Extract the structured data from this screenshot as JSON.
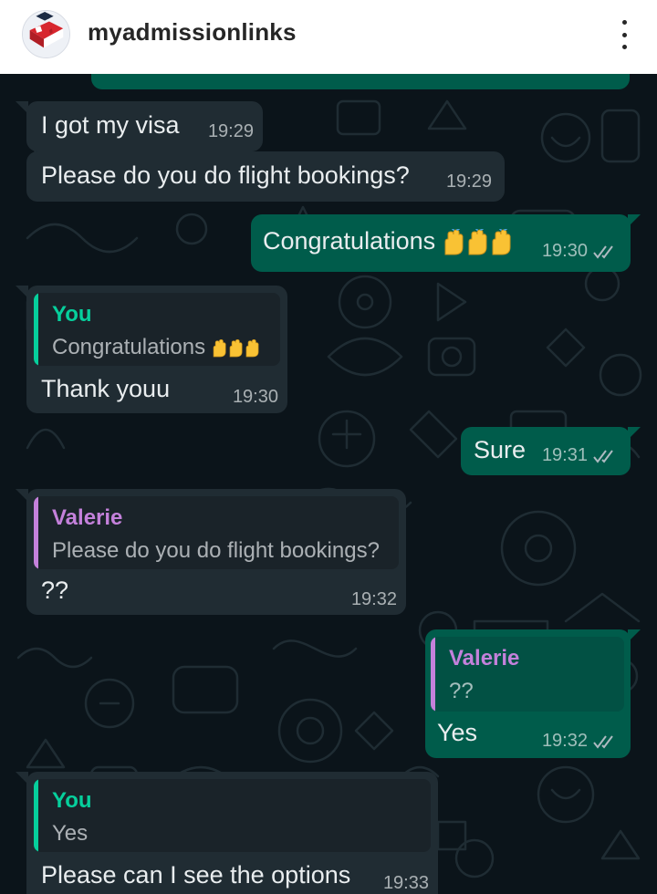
{
  "header": {
    "account_name": "myadmissionlinks",
    "menu_icon": "more-vertical-icon"
  },
  "colors": {
    "chat_bg": "#0b141a",
    "incoming_bubble": "#202c33",
    "outgoing_bubble": "#005c4b",
    "you_name": "#06cf9c",
    "valerie_name": "#c481db",
    "read_ticks": "#aebac1"
  },
  "messages": [
    {
      "text": "I got my visa",
      "time": "19:29"
    },
    {
      "text": "Please do you do flight bookings?",
      "time": "19:29"
    },
    {
      "text": "Congratulations",
      "emoji": "raising-hands-x3",
      "time": "19:30",
      "status": "read"
    },
    {
      "quote_name": "You",
      "quote_text": "Congratulations",
      "text": "Thank youu",
      "time": "19:30"
    },
    {
      "text": "Sure",
      "time": "19:31",
      "status": "read"
    },
    {
      "quote_name": "Valerie",
      "quote_text": "Please do you do flight bookings?",
      "text": "??",
      "time": "19:32"
    },
    {
      "quote_name": "Valerie",
      "quote_text": "??",
      "text": "Yes",
      "time": "19:32",
      "status": "read"
    },
    {
      "quote_name": "You",
      "quote_text": "Yes",
      "text": "Please can I see the options",
      "time": "19:33"
    }
  ]
}
